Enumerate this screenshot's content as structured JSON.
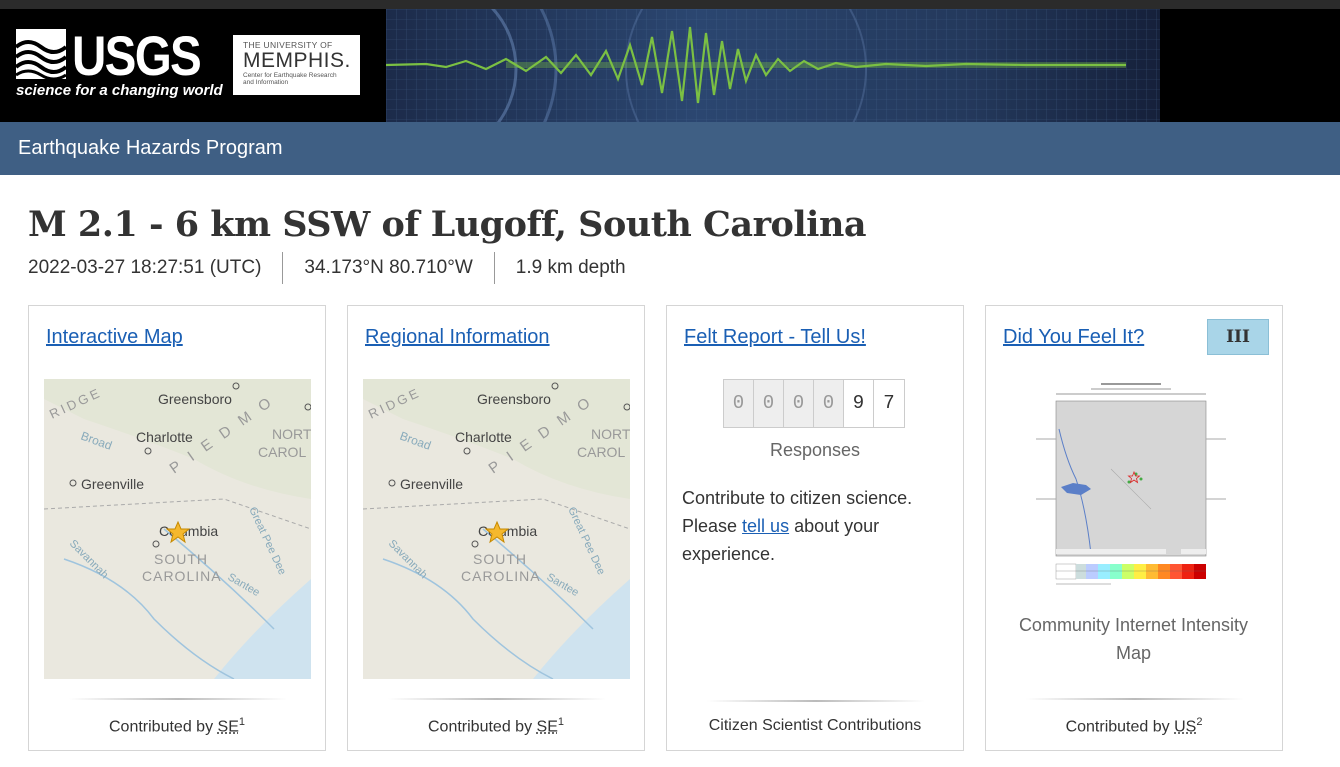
{
  "header": {
    "usgs_word": "USGS",
    "usgs_tagline": "science for a changing world",
    "memphis_top": "THE UNIVERSITY OF",
    "memphis_name": "MEMPHIS.",
    "memphis_sub1": "Center for Earthquake Research",
    "memphis_sub2": "and Information"
  },
  "nav": {
    "title": "Earthquake Hazards Program"
  },
  "event": {
    "title": "M 2.1 - 6 km SSW of Lugoff, South Carolina",
    "time": "2022-03-27 18:27:51 (UTC)",
    "location": "34.173°N 80.710°W",
    "depth": "1.9 km depth"
  },
  "map_labels": {
    "ridge": "RIDGE",
    "greensboro": "Greensboro",
    "charlotte": "Charlotte",
    "piedmont": "P I E D M O",
    "north_carolina_1": "NORT",
    "north_carolina_2": "CAROL",
    "broad": "Broad",
    "greenville": "Greenville",
    "columbia": "Columbia",
    "south": "SOUTH",
    "carolina": "CAROLINA",
    "savannah": "Savannah",
    "santee": "Santee",
    "great_pee_dee": "Great Pee Dee"
  },
  "cards": {
    "interactive_map": {
      "link": "Interactive Map",
      "contributed_by": "Contributed by ",
      "network": "SE",
      "footnote": "1"
    },
    "regional_info": {
      "link": "Regional Information",
      "contributed_by": "Contributed by ",
      "network": "SE",
      "footnote": "1"
    },
    "felt_report": {
      "link": "Felt Report - Tell Us!",
      "digits": [
        "0",
        "0",
        "0",
        "0",
        "9",
        "7"
      ],
      "responses_label": "Responses",
      "contrib_text_1": "Contribute to citizen science. Please ",
      "contrib_link": "tell us",
      "contrib_text_2": " about your experience.",
      "footer": "Citizen Scientist Contributions"
    },
    "dyfi": {
      "link": "Did You Feel It?",
      "intensity_badge": "III",
      "caption": "Community Internet Intensity Map",
      "contributed_by": "Contributed by ",
      "network": "US",
      "footnote": "2"
    }
  },
  "colors": {
    "nav": "#3f5f84",
    "link": "#1a5fb4",
    "badge": "#a9d5e8",
    "seismo_trace": "#7bc043"
  }
}
